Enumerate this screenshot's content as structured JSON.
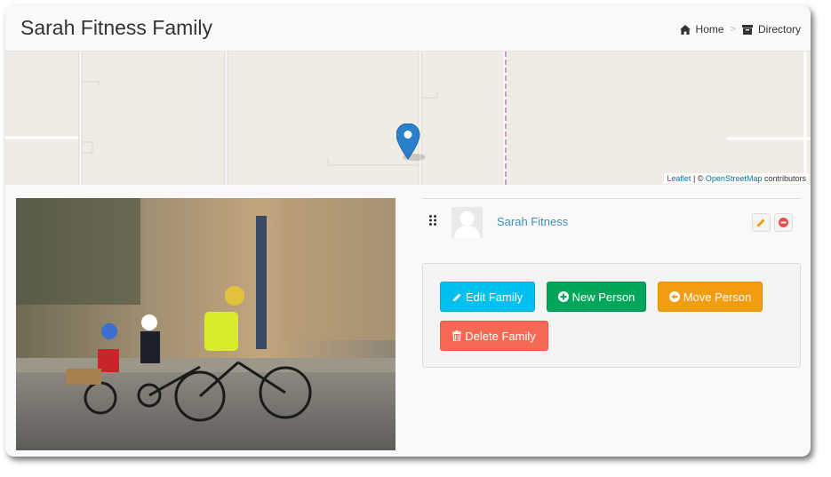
{
  "header": {
    "title": "Sarah Fitness Family",
    "breadcrumb": [
      {
        "label": "Home",
        "icon": "home-icon"
      },
      {
        "label": "Directory",
        "icon": "archive-icon"
      }
    ],
    "separator": ">"
  },
  "map": {
    "attribution_leaflet": "Leaflet",
    "attribution_sep": " | © ",
    "attribution_osm": "OpenStreetMap",
    "attribution_suffix": " contributors",
    "marker_color": "#2a81cb"
  },
  "member": {
    "name": "Sarah Fitness"
  },
  "actions": {
    "edit_family": "Edit Family",
    "new_person": "New Person",
    "move_person": "Move Person",
    "delete_family": "Delete Family"
  },
  "colors": {
    "link": "#3c8dbc",
    "info": "#00c0ef",
    "success": "#00a65a",
    "warning": "#f39c12",
    "danger": "#f56954"
  }
}
